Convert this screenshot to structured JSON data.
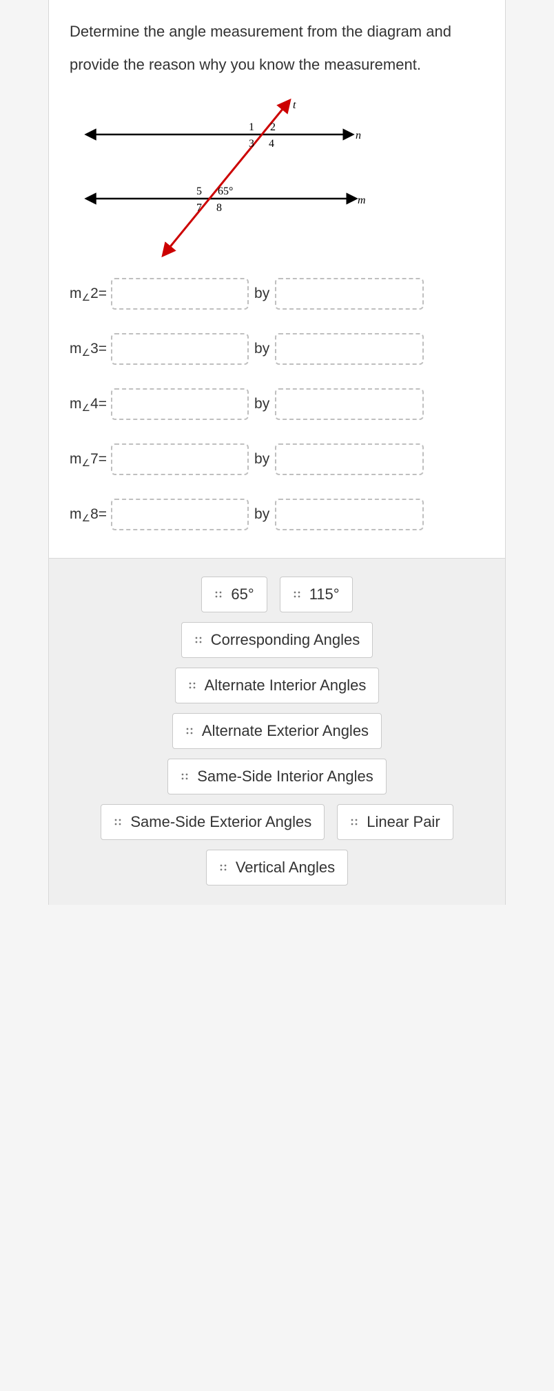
{
  "question": {
    "text": "Determine the angle measurement from the diagram and provide the reason why you know the measurement."
  },
  "diagram": {
    "line_n": "n",
    "line_m": "m",
    "line_t": "t",
    "angles": {
      "a1": "1",
      "a2": "2",
      "a3": "3",
      "a4": "4",
      "a5": "5",
      "a6": "65°",
      "a7": "7",
      "a8": "8"
    }
  },
  "rows": [
    {
      "prefix": "m",
      "sub": "∠",
      "num": "2",
      "eq": " =",
      "by": "by"
    },
    {
      "prefix": "m",
      "sub": "∠",
      "num": "3",
      "eq": " =",
      "by": "by"
    },
    {
      "prefix": "m",
      "sub": "∠",
      "num": "4",
      "eq": " =",
      "by": "by"
    },
    {
      "prefix": "m",
      "sub": "∠",
      "num": "7",
      "eq": " =",
      "by": "by"
    },
    {
      "prefix": "m",
      "sub": "∠",
      "num": "8",
      "eq": " =",
      "by": "by"
    }
  ],
  "bank": {
    "t0": "65°",
    "t1": "115°",
    "t2": "Corresponding Angles",
    "t3": "Alternate Interior Angles",
    "t4": "Alternate Exterior Angles",
    "t5": "Same-Side Interior Angles",
    "t6": "Same-Side Exterior Angles",
    "t7": "Linear Pair",
    "t8": "Vertical Angles"
  }
}
